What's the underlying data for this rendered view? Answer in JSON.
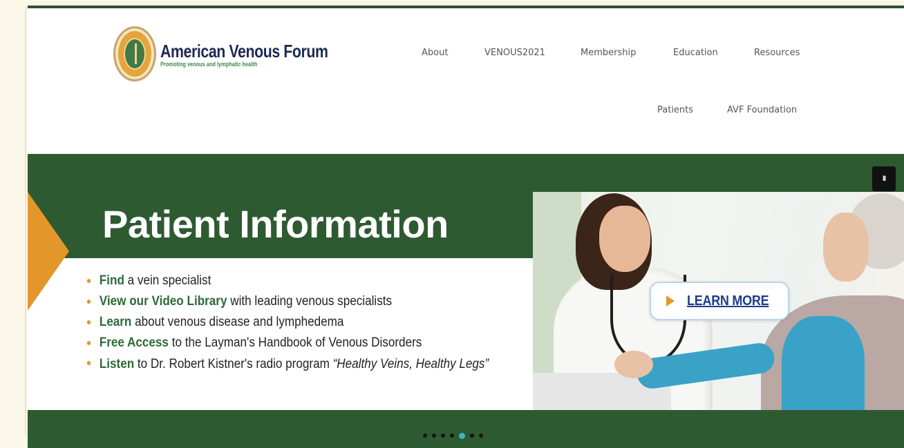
{
  "header": {
    "logo": {
      "title": "American Venous Forum",
      "tagline": "Promoting venous and lymphatic health"
    },
    "nav_primary": [
      {
        "label": "About"
      },
      {
        "label": "VENOUS2021"
      },
      {
        "label": "Membership"
      },
      {
        "label": "Education"
      },
      {
        "label": "Resources"
      }
    ],
    "nav_secondary": [
      {
        "label": "Patients"
      },
      {
        "label": "AVF Foundation"
      }
    ]
  },
  "hero": {
    "pause_label": "II",
    "slide": {
      "title": "Patient Information",
      "bullets": [
        {
          "keyword": "Find",
          "text": " a vein specialist"
        },
        {
          "keyword": "View our Video Library",
          "text": " with leading venous specialists"
        },
        {
          "keyword": "Learn",
          "text": " about venous disease and lymphedema"
        },
        {
          "keyword": "Free Access",
          "text": " to the Layman's Handbook of Venous Disorders"
        },
        {
          "keyword": "Listen",
          "text": " to Dr. Robert Kistner's radio program ",
          "quote": "“Healthy Veins, Healthy Legs”"
        }
      ],
      "cta_label": "LEARN MORE"
    },
    "carousel": {
      "count": 7,
      "active_index": 4
    }
  },
  "colors": {
    "brand_green": "#2e5a32",
    "accent_orange": "#e3972b",
    "link_blue": "#1a3d8a",
    "active_dot": "#39b6c9"
  }
}
